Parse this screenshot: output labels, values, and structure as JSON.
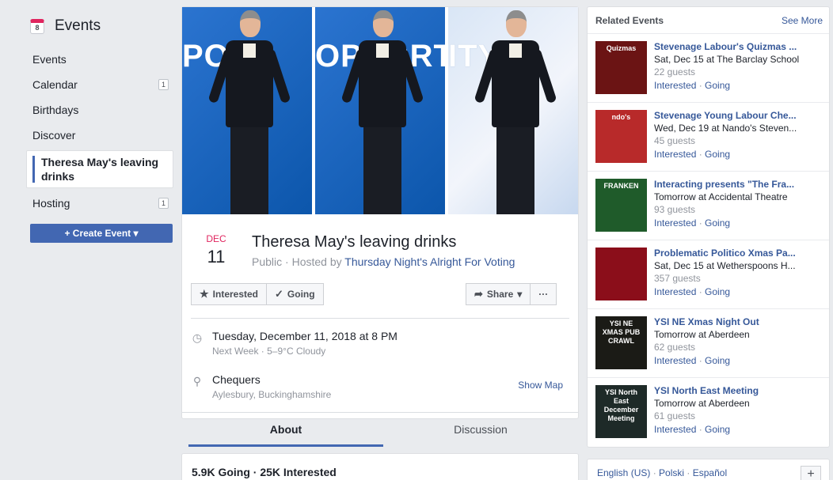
{
  "sidebar": {
    "title": "Events",
    "calendar_icon_day": "8",
    "items": [
      {
        "label": "Events",
        "count": ""
      },
      {
        "label": "Calendar",
        "count": "1"
      },
      {
        "label": "Birthdays",
        "count": ""
      },
      {
        "label": "Discover",
        "count": ""
      },
      {
        "label": "Theresa May's leaving drinks",
        "count": ""
      },
      {
        "label": "Hosting",
        "count": "1"
      }
    ],
    "create_event": "Create Event"
  },
  "event": {
    "cover_text": [
      "POR",
      "OPPORTUNI",
      "ITY"
    ],
    "month": "DEC",
    "day": "11",
    "title": "Theresa May's leaving drinks",
    "privacy": "Public",
    "hosted_by_prefix": "Hosted by",
    "host": "Thursday Night's Alright For Voting",
    "buttons": {
      "interested": "Interested",
      "going": "Going",
      "share": "Share",
      "more": "···"
    },
    "datetime": "Tuesday, December 11, 2018 at 8 PM",
    "weather": "Next Week · 5–9°C Cloudy",
    "place": "Chequers",
    "place_sub": "Aylesbury, Buckinghamshire",
    "show_map": "Show Map",
    "tabs": [
      "About",
      "Discussion"
    ],
    "stats": "5.9K Going · 25K Interested"
  },
  "related": {
    "header": "Related Events",
    "see_more": "See More",
    "events": [
      {
        "title": "Stevenage Labour's Quizmas ...",
        "line1": "Sat, Dec 15 at The Barclay School",
        "guests": "22 guests",
        "thumb": "Quizmas",
        "color": "#6b1414"
      },
      {
        "title": "Stevenage Young Labour Che...",
        "line1": "Wed, Dec 19 at Nando's Steven...",
        "guests": "45 guests",
        "thumb": "ndo's",
        "color": "#b82a2a"
      },
      {
        "title": "Interacting presents \"The Fra...",
        "line1": "Tomorrow at Accidental Theatre",
        "guests": "93 guests",
        "thumb": "FRANKEN",
        "color": "#1f5b2a"
      },
      {
        "title": "Problematic Politico Xmas Pa...",
        "line1": "Sat, Dec 15 at Wetherspoons H...",
        "guests": "357 guests",
        "thumb": "",
        "color": "#8b0e1a"
      },
      {
        "title": "YSI NE Xmas Night Out",
        "line1": "Tomorrow at Aberdeen",
        "guests": "62 guests",
        "thumb": "YSI NE XMAS PUB CRAWL",
        "color": "#1b1b16"
      },
      {
        "title": "YSI North East Meeting",
        "line1": "Tomorrow at Aberdeen",
        "guests": "61 guests",
        "thumb": "YSI North East December Meeting",
        "color": "#1e2a28"
      }
    ],
    "interested": "Interested",
    "going": "Going"
  },
  "footer": {
    "languages": [
      "English (US)",
      "Polski",
      "Español"
    ],
    "plus": "+"
  }
}
